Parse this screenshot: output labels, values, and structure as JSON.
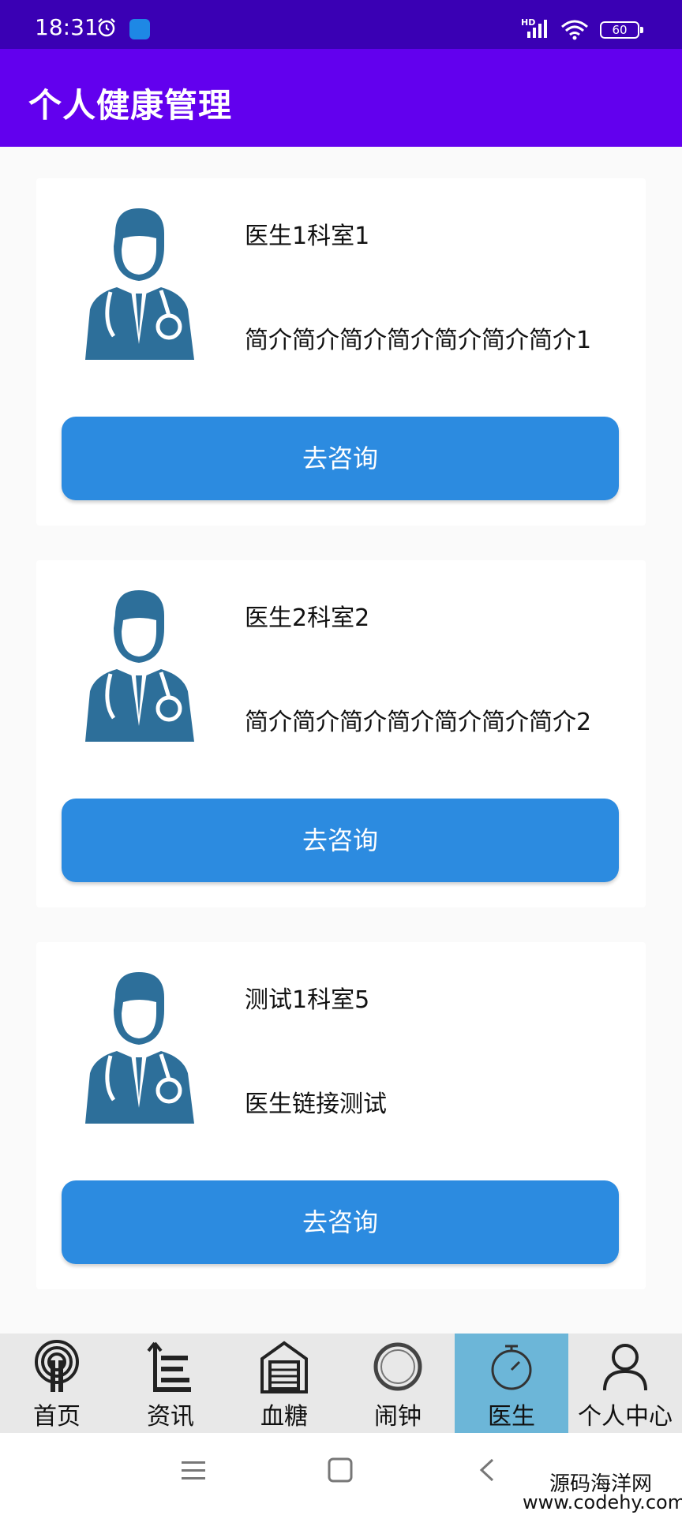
{
  "status_bar": {
    "time": "18:31",
    "network": "HD",
    "battery": "60"
  },
  "app_bar": {
    "title": "个人健康管理"
  },
  "doctors": [
    {
      "name": "医生1科室1",
      "intro": "简介简介简介简介简介简介简介1",
      "button": "去咨询"
    },
    {
      "name": "医生2科室2",
      "intro": "简介简介简介简介简介简介简介2",
      "button": "去咨询"
    },
    {
      "name": "测试1科室5",
      "intro": "医生链接测试",
      "button": "去咨询"
    }
  ],
  "bottom_nav": {
    "active": "医生",
    "items": [
      {
        "label": "首页",
        "icon": "home-antenna-icon"
      },
      {
        "label": "资讯",
        "icon": "news-list-icon"
      },
      {
        "label": "血糖",
        "icon": "blood-sugar-icon"
      },
      {
        "label": "闹钟",
        "icon": "alarm-ring-icon"
      },
      {
        "label": "医生",
        "icon": "stopwatch-icon"
      },
      {
        "label": "个人中心",
        "icon": "user-icon"
      }
    ]
  },
  "watermark": {
    "name": "源码海洋网",
    "url": "www.codehy.com"
  },
  "colors": {
    "status_bar": "#3a00b4",
    "app_bar": "#6200ee",
    "button": "#2c8be0",
    "active_tab": "#6cb6d8"
  }
}
